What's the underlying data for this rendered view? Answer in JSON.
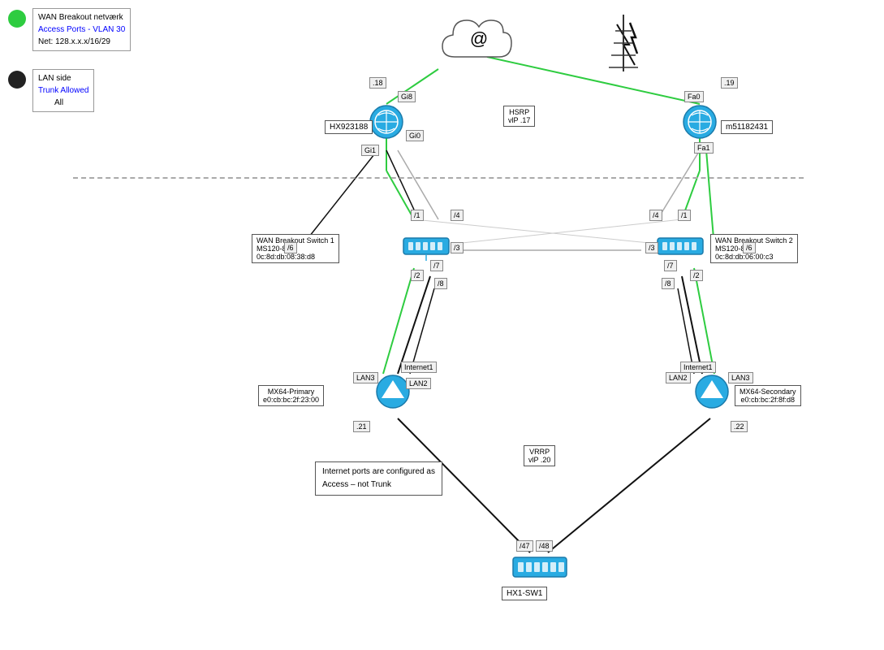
{
  "legend": {
    "wan_title": "WAN Breakout netværk",
    "wan_access": "Access Ports - VLAN 30",
    "wan_net": "Net: 128.x.x.x/16/29",
    "lan_title": "LAN side",
    "lan_trunk": "Trunk   Allowed",
    "lan_all": "All"
  },
  "nodes": {
    "cloud_symbol": "@",
    "hsrp_label": "HSRP\nvlP .17",
    "vrrp_label": "VRRP\nvlP .20",
    "hx923188": "HX923188",
    "m51182431": "m51182431",
    "wan_sw1_label": "WAN Breakout Switch 1\nMS120-8LP\n0c:8d:db:08:38:d8",
    "wan_sw2_label": "WAN Breakout Switch 2\nMS120-8LP\n0c:8d:db:06:00:c3",
    "mx64_primary": "MX64-Primary\ne0:cb:bc:2f:23:00",
    "mx64_secondary": "MX64-Secondary\ne0:cb:bc:2f:8f:d8",
    "hx1_sw1": "HX1-SW1",
    "ip_18": ".18",
    "ip_19": ".19",
    "ip_21": ".21",
    "ip_22": ".22",
    "info_box": "Internet ports are configured as\nAccess – not Trunk"
  },
  "ports": {
    "gi8": "Gi8",
    "gi0": "Gi0",
    "gi1": "Gi1",
    "fa0": "Fa0",
    "fa1": "Fa1",
    "sw1_1": "/1",
    "sw1_2": "/2",
    "sw1_3": "/3",
    "sw1_4": "/4",
    "sw1_6": "/6",
    "sw1_7": "/7",
    "sw1_8": "/8",
    "sw2_1": "/1",
    "sw2_2": "/2",
    "sw2_3": "/3",
    "sw2_4": "/4",
    "sw2_6": "/6",
    "sw2_7": "/7",
    "sw2_8": "/8",
    "mx_lan2": "LAN2",
    "mx_lan3": "LAN3",
    "mx_internet1": "Internet1",
    "mx2_lan2": "LAN2",
    "mx2_lan3": "LAN3",
    "mx2_internet1": "Internet1",
    "p47": "/47",
    "p48": "/48"
  },
  "colors": {
    "green_line": "#2ecc40",
    "black_line": "#111",
    "gray_line": "#aaa",
    "router_fill": "#29abe2",
    "switch_fill": "#29abe2"
  }
}
